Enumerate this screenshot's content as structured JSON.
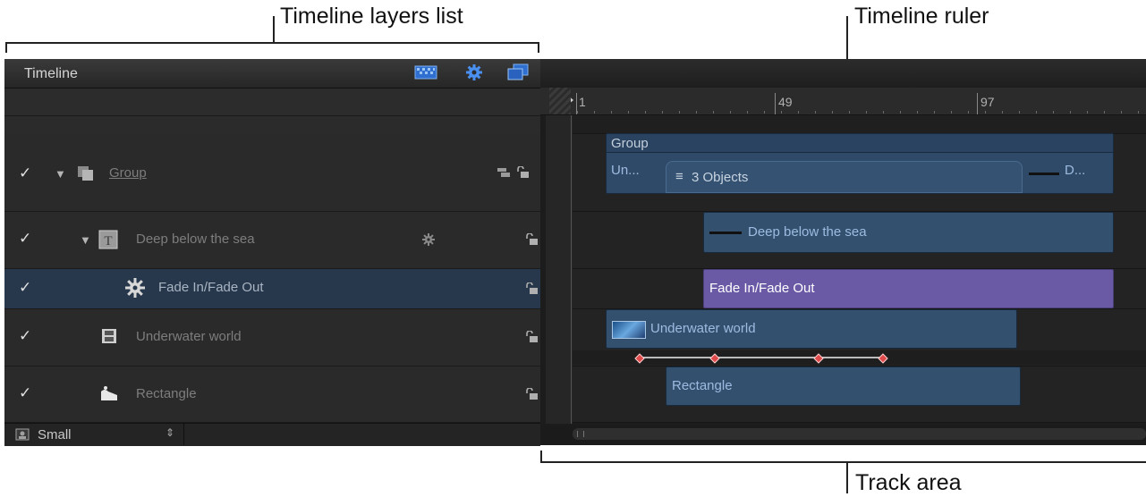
{
  "callouts": {
    "layers_list": "Timeline layers list",
    "ruler": "Timeline ruler",
    "track_area": "Track area"
  },
  "panel": {
    "title": "Timeline"
  },
  "layers": [
    {
      "name": "Group",
      "checked": true
    },
    {
      "name": "Deep below the sea",
      "checked": true
    },
    {
      "name": "Fade In/Fade Out",
      "checked": true
    },
    {
      "name": "Underwater world",
      "checked": true
    },
    {
      "name": "Rectangle",
      "checked": true
    }
  ],
  "footer": {
    "size_label": "Small"
  },
  "ruler": {
    "ticks": [
      "1",
      "49",
      "97"
    ]
  },
  "tracks": {
    "group_label": "Group",
    "group_left": "Un...",
    "group_objects": "3 Objects",
    "group_right": "D...",
    "deep": "Deep below the sea",
    "fade": "Fade In/Fade Out",
    "underwater": "Underwater world",
    "rectangle": "Rectangle"
  },
  "colors": {
    "accent": "#3b7fe0",
    "clip_blue": "#33506f",
    "clip_purple": "#6a5aa6",
    "keyframe": "#e04a4a"
  }
}
